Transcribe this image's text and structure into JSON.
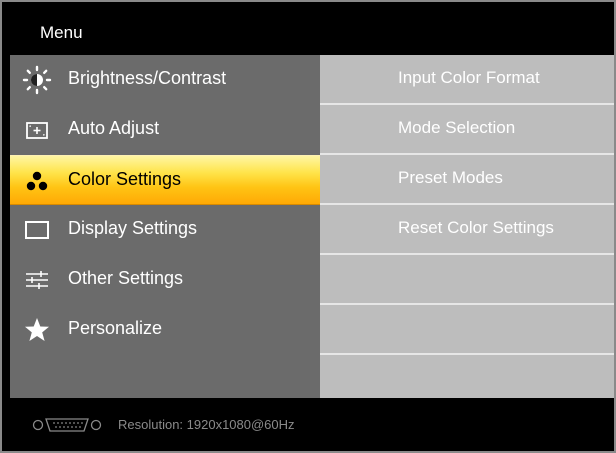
{
  "header": {
    "title": "Menu"
  },
  "menu": {
    "items": [
      {
        "label": "Brightness/Contrast",
        "icon": "brightness-icon"
      },
      {
        "label": "Auto Adjust",
        "icon": "auto-adjust-icon"
      },
      {
        "label": "Color Settings",
        "icon": "color-settings-icon",
        "selected": true
      },
      {
        "label": "Display Settings",
        "icon": "display-icon"
      },
      {
        "label": "Other Settings",
        "icon": "sliders-icon"
      },
      {
        "label": "Personalize",
        "icon": "star-icon"
      }
    ]
  },
  "submenu": {
    "items": [
      {
        "label": "Input Color Format"
      },
      {
        "label": "Mode Selection"
      },
      {
        "label": "Preset Modes"
      },
      {
        "label": "Reset Color Settings"
      },
      {
        "label": ""
      },
      {
        "label": ""
      },
      {
        "label": ""
      }
    ]
  },
  "footer": {
    "connector_icon": "vga-connector-icon",
    "resolution_text": "Resolution:  1920x1080@60Hz"
  },
  "colors": {
    "selected_top": "#fff6a3",
    "selected_bottom": "#ffa905",
    "left_panel": "#6b6b6b",
    "right_panel": "#bdbdbd"
  }
}
